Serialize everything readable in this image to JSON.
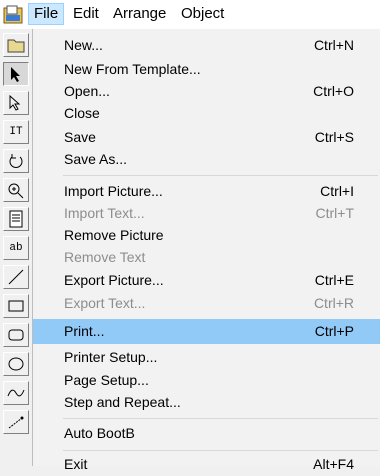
{
  "menubar": {
    "items": [
      {
        "label": "File",
        "active": true
      },
      {
        "label": "Edit"
      },
      {
        "label": "Arrange"
      },
      {
        "label": "Object"
      }
    ]
  },
  "toolbar": {
    "tools": [
      {
        "name": "open-icon"
      },
      {
        "name": "select-arrow-icon",
        "pressed": true
      },
      {
        "name": "node-edit-icon"
      },
      {
        "name": "text-tool-icon",
        "glyph": "IT"
      },
      {
        "name": "rotate-icon"
      },
      {
        "name": "zoom-icon"
      },
      {
        "name": "page-icon"
      },
      {
        "name": "text-field-icon",
        "glyph": "ab"
      },
      {
        "name": "line-icon"
      },
      {
        "name": "rectangle-icon"
      },
      {
        "name": "rounded-rectangle-icon"
      },
      {
        "name": "ellipse-icon"
      },
      {
        "name": "curve-icon"
      },
      {
        "name": "pen-icon"
      }
    ]
  },
  "file_menu": {
    "items": [
      {
        "label": "New...",
        "shortcut": "Ctrl+N"
      },
      {
        "label": "New From Template...",
        "shortcut": ""
      },
      {
        "label": "Open...",
        "shortcut": "Ctrl+O"
      },
      {
        "label": "Close",
        "shortcut": ""
      },
      {
        "label": "Save",
        "shortcut": "Ctrl+S"
      },
      {
        "label": "Save As...",
        "shortcut": ""
      },
      {
        "separator": true
      },
      {
        "label": "Import Picture...",
        "shortcut": "Ctrl+I"
      },
      {
        "label": "Import Text...",
        "shortcut": "Ctrl+T",
        "disabled": true
      },
      {
        "label": "Remove Picture",
        "shortcut": ""
      },
      {
        "label": "Remove Text",
        "shortcut": "",
        "disabled": true
      },
      {
        "label": "Export Picture...",
        "shortcut": "Ctrl+E"
      },
      {
        "label": "Export Text...",
        "shortcut": "Ctrl+R",
        "disabled": true
      },
      {
        "separator": true
      },
      {
        "label": "Print...",
        "shortcut": "Ctrl+P",
        "highlighted": true
      },
      {
        "label": "Printer Setup...",
        "shortcut": ""
      },
      {
        "label": "Page Setup...",
        "shortcut": ""
      },
      {
        "label": "Step and Repeat...",
        "shortcut": ""
      },
      {
        "separator": true
      },
      {
        "label": "Auto BootB",
        "shortcut": ""
      },
      {
        "separator": true
      },
      {
        "label": "Exit",
        "shortcut": "Alt+F4"
      }
    ]
  },
  "colors": {
    "highlight": "#91c9f7",
    "menubar_active": "#cce8ff",
    "disabled_text": "#8d8d8d"
  }
}
